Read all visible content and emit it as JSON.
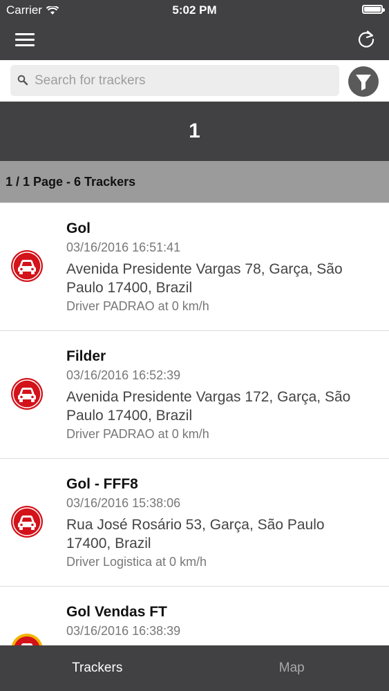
{
  "status_bar": {
    "carrier": "Carrier",
    "time": "5:02 PM"
  },
  "nav": {
    "menu_icon": "hamburger-menu-icon",
    "refresh_icon": "refresh-icon"
  },
  "search": {
    "placeholder": "Search for trackers",
    "value": "",
    "filter_icon": "filter-icon"
  },
  "pager": {
    "current_page": "1",
    "info": "1 / 1 Page - 6 Trackers"
  },
  "colors": {
    "bar": "#414042",
    "pager_bg": "#9b9b9b",
    "car_red": "#d3121a",
    "car_yellow": "#f2b400"
  },
  "trackers": [
    {
      "name": "Gol",
      "timestamp": "03/16/2016 16:51:41",
      "address": "Avenida Presidente Vargas 78, Garça, São Paulo 17400, Brazil",
      "driver": "Driver PADRAO at 0 km/h",
      "icon": "car-icon"
    },
    {
      "name": "Filder",
      "timestamp": "03/16/2016 16:52:39",
      "address": "Avenida Presidente Vargas 172, Garça, São Paulo 17400, Brazil",
      "driver": "Driver PADRAO at 0 km/h",
      "icon": "car-icon"
    },
    {
      "name": "Gol - FFF8",
      "timestamp": "03/16/2016 15:38:06",
      "address": "Rua José Rosário 53, Garça, São Paulo 17400, Brazil",
      "driver": "Driver Logistica at 0 km/h",
      "icon": "car-icon"
    },
    {
      "name": "Gol Vendas FT",
      "timestamp": "03/16/2016 16:38:39",
      "address": "",
      "driver": "",
      "icon": "car-icon"
    }
  ],
  "tabs": [
    {
      "label": "Trackers",
      "active": true
    },
    {
      "label": "Map",
      "active": false
    }
  ]
}
